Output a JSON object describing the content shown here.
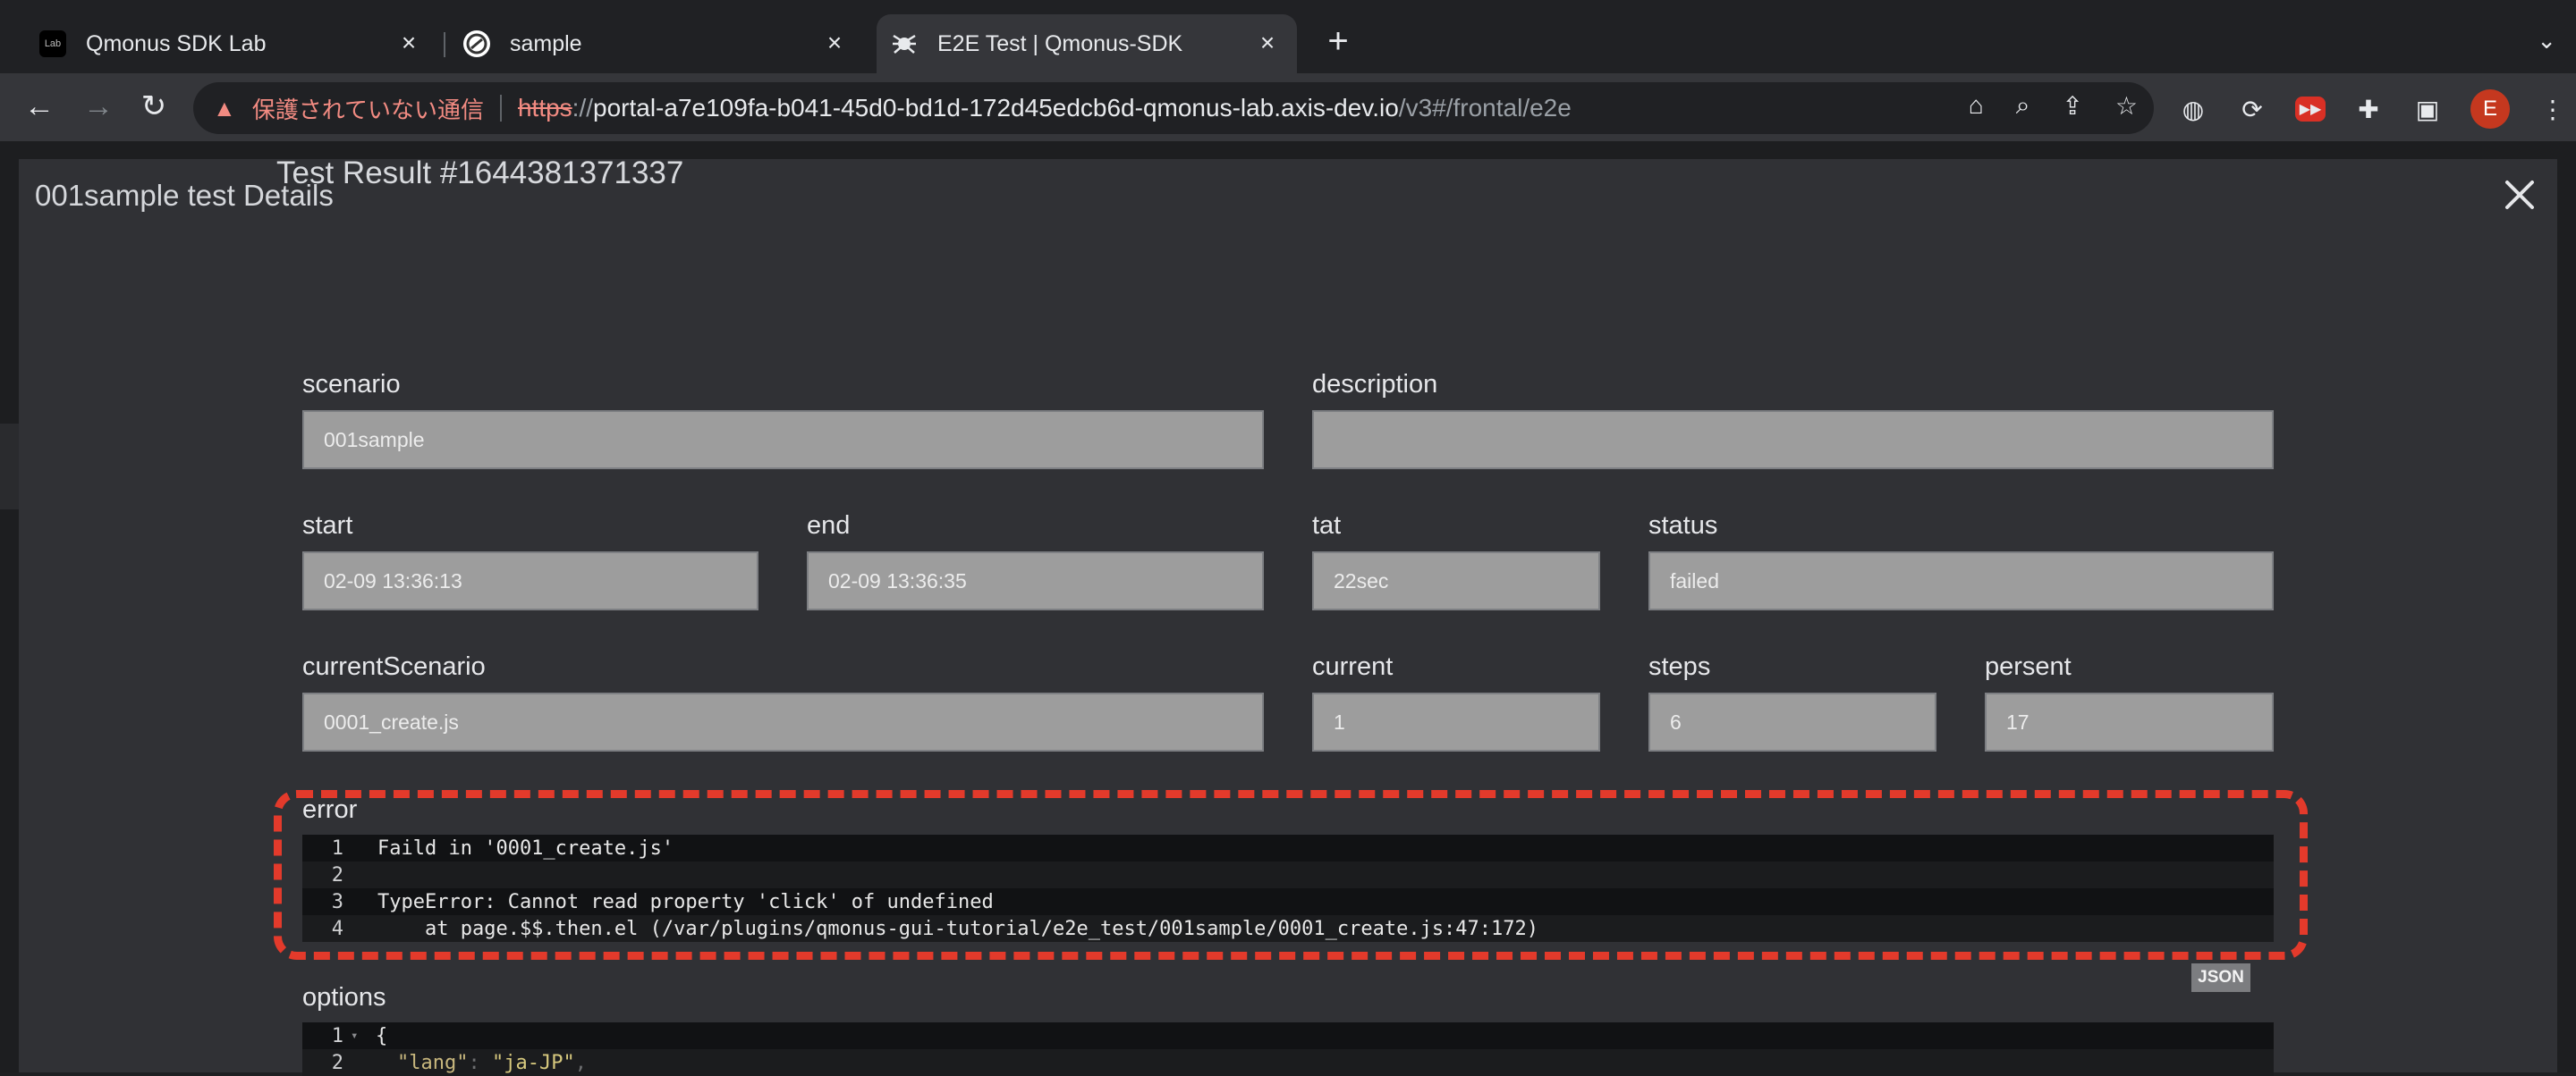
{
  "browser": {
    "tabs": [
      {
        "title": "Qmonus SDK Lab",
        "icon": "qmonus-icon"
      },
      {
        "title": "sample",
        "icon": "sample-icon"
      },
      {
        "title": "E2E Test | Qmonus-SDK",
        "icon": "e2e-icon"
      }
    ],
    "omnibox": {
      "not_secure": "保護されていない通信",
      "scheme": "https",
      "scheme_sep": "://",
      "host": "portal-a7e109fa-b041-45d0-bd1d-172d45edcb6d-qmonus-lab.axis-dev.io",
      "path": "/v3#/frontal/e2e"
    },
    "profile_initial": "E"
  },
  "modal": {
    "title": "001sample test Details",
    "result_title": "Test Result #1644381371337",
    "fields": {
      "scenario": {
        "label": "scenario",
        "value": "001sample"
      },
      "description": {
        "label": "description",
        "value": ""
      },
      "start": {
        "label": "start",
        "value": "02-09 13:36:13"
      },
      "end": {
        "label": "end",
        "value": "02-09 13:36:35"
      },
      "tat": {
        "label": "tat",
        "value": "22sec"
      },
      "status": {
        "label": "status",
        "value": "failed"
      },
      "currentScenario": {
        "label": "currentScenario",
        "value": "0001_create.js"
      },
      "current": {
        "label": "current",
        "value": "1"
      },
      "steps": {
        "label": "steps",
        "value": "6"
      },
      "persent": {
        "label": "persent",
        "value": "17"
      }
    },
    "error": {
      "label": "error",
      "lines": [
        {
          "n": "1",
          "text": "Faild in '0001_create.js'"
        },
        {
          "n": "2",
          "text": ""
        },
        {
          "n": "3",
          "text": "TypeError: Cannot read property 'click' of undefined"
        },
        {
          "n": "4",
          "text": "    at page.$$.then.el (/var/plugins/qmonus-gui-tutorial/e2e_test/001sample/0001_create.js:47:172)"
        }
      ]
    },
    "options": {
      "label": "options",
      "badge": "JSON",
      "lines": [
        {
          "n": "1",
          "text": "{"
        },
        {
          "n": "2",
          "key": "\"lang\"",
          "value": "\"ja-JP\""
        }
      ]
    }
  }
}
